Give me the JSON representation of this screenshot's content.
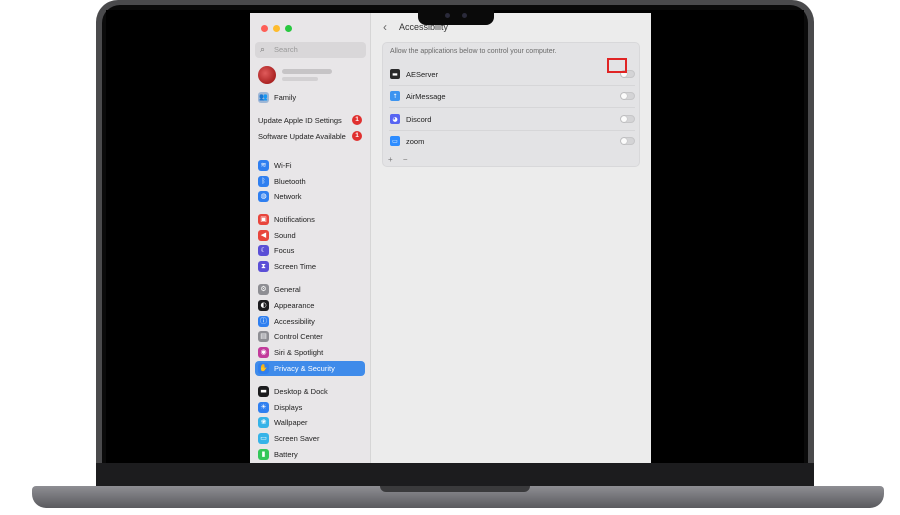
{
  "window": {
    "title": "Accessibility",
    "description": "Allow the applications below to control your computer."
  },
  "search": {
    "placeholder": "Search"
  },
  "sidebar": {
    "family_label": "Family",
    "update_apple_id": {
      "label": "Update Apple ID Settings",
      "badge": "1"
    },
    "software_update": {
      "label": "Software Update Available",
      "badge": "1"
    },
    "items": [
      {
        "label": "Wi-Fi",
        "icon": "wifi-icon",
        "color": "#2f7ff0"
      },
      {
        "label": "Bluetooth",
        "icon": "bluetooth-icon",
        "color": "#2f7ff0"
      },
      {
        "label": "Network",
        "icon": "network-icon",
        "color": "#2f7ff0"
      },
      {
        "label": "Notifications",
        "icon": "notifications-icon",
        "color": "#e8453c"
      },
      {
        "label": "Sound",
        "icon": "sound-icon",
        "color": "#e8453c"
      },
      {
        "label": "Focus",
        "icon": "focus-icon",
        "color": "#5b4fd6"
      },
      {
        "label": "Screen Time",
        "icon": "screen-time-icon",
        "color": "#5b4fd6"
      },
      {
        "label": "General",
        "icon": "gear-icon",
        "color": "#8e8e93"
      },
      {
        "label": "Appearance",
        "icon": "appearance-icon",
        "color": "#1c1c1e"
      },
      {
        "label": "Accessibility",
        "icon": "accessibility-icon",
        "color": "#2f7ff0"
      },
      {
        "label": "Control Center",
        "icon": "control-center-icon",
        "color": "#8e8e93"
      },
      {
        "label": "Siri & Spotlight",
        "icon": "siri-icon",
        "color": "#c23b9b"
      },
      {
        "label": "Privacy & Security",
        "icon": "hand-icon",
        "color": "#2f7ff0",
        "selected": true
      },
      {
        "label": "Desktop & Dock",
        "icon": "dock-icon",
        "color": "#1c1c1e"
      },
      {
        "label": "Displays",
        "icon": "displays-icon",
        "color": "#2f7ff0"
      },
      {
        "label": "Wallpaper",
        "icon": "wallpaper-icon",
        "color": "#36b3e8"
      },
      {
        "label": "Screen Saver",
        "icon": "screen-saver-icon",
        "color": "#36b3e8"
      },
      {
        "label": "Battery",
        "icon": "battery-icon",
        "color": "#34c759"
      }
    ]
  },
  "apps": [
    {
      "name": "AEServer",
      "icon": "aeserver-icon",
      "color": "#2a2a2a",
      "enabled": false
    },
    {
      "name": "AirMessage",
      "icon": "airmessage-icon",
      "color": "#3d94f0",
      "enabled": false
    },
    {
      "name": "Discord",
      "icon": "discord-icon",
      "color": "#5865f2",
      "enabled": false
    },
    {
      "name": "zoom",
      "icon": "zoom-icon",
      "color": "#2d8cff",
      "enabled": false
    }
  ],
  "footer": {
    "add": "+",
    "remove": "−"
  }
}
